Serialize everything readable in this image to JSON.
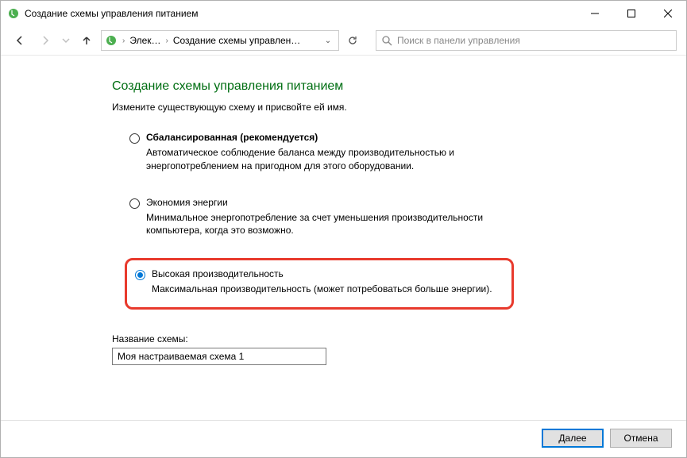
{
  "window": {
    "title": "Создание схемы управления питанием"
  },
  "breadcrumb": {
    "item1": "Элек…",
    "item2": "Создание схемы управлен…"
  },
  "search": {
    "placeholder": "Поиск в панели управления"
  },
  "page": {
    "heading": "Создание схемы управления питанием",
    "subheading": "Измените существующую схему и присвойте ей имя."
  },
  "options": {
    "balanced": {
      "title": "Сбалансированная (рекомендуется)",
      "desc": "Автоматическое соблюдение баланса между производительностью и энергопотреблением на пригодном для этого оборудовании."
    },
    "saver": {
      "title": "Экономия энергии",
      "desc": "Минимальное энергопотребление за счет уменьшения производительности компьютера, когда это возможно."
    },
    "performance": {
      "title": "Высокая производительность",
      "desc": "Максимальная производительность (может потребоваться больше энергии)."
    }
  },
  "scheme_name": {
    "label": "Название схемы:",
    "value": "Моя настраиваемая схема 1"
  },
  "buttons": {
    "next": "Далее",
    "cancel": "Отмена"
  }
}
